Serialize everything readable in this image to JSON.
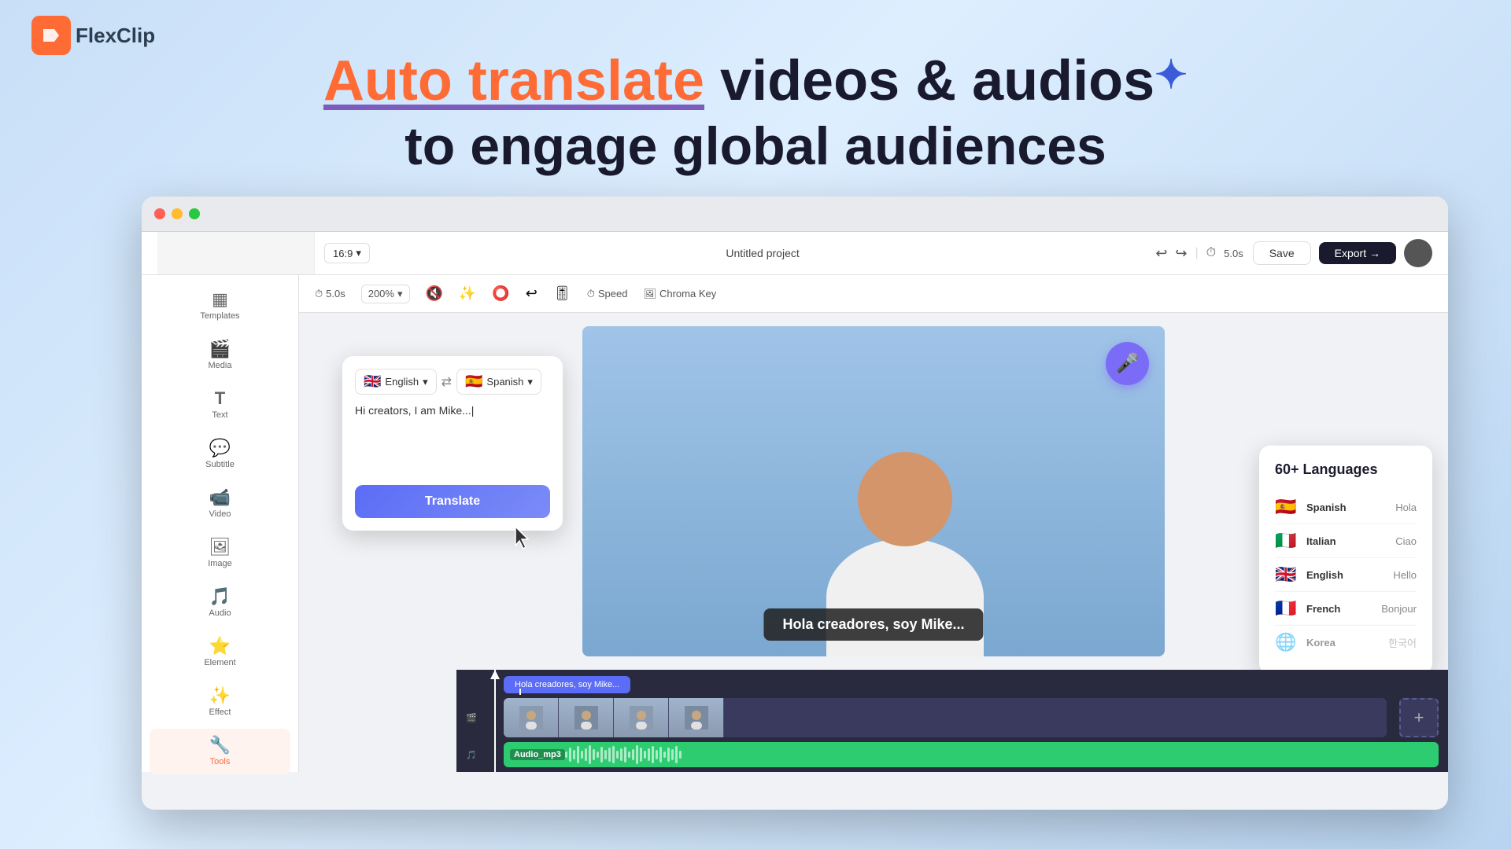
{
  "logo": {
    "icon": "F",
    "text": "FlexClip"
  },
  "hero": {
    "line1_highlight": "Auto translate",
    "line1_rest": " videos & audios",
    "line2": "to engage global audiences",
    "sparkle": "✦"
  },
  "window": {
    "titlebar": {
      "buttons": [
        "red",
        "yellow",
        "green"
      ]
    }
  },
  "toolbar": {
    "ratio": "16:9",
    "title": "Untitled project",
    "undo_label": "↩",
    "redo_label": "↪",
    "save_label": "Save",
    "export_label": "Export →",
    "time": "5.0s",
    "zoom": "200%"
  },
  "sub_toolbar": {
    "items": [
      "🔇",
      "✨",
      "⭕",
      "↩",
      "🎚",
      "⏱ Speed",
      "🖼 Chroma Key"
    ]
  },
  "sidebar": {
    "items": [
      {
        "id": "templates",
        "icon": "▦",
        "label": "Templates"
      },
      {
        "id": "media",
        "icon": "🎬",
        "label": "Media"
      },
      {
        "id": "text",
        "icon": "T",
        "label": "Text"
      },
      {
        "id": "subtitle",
        "icon": "💬",
        "label": "Subtitle"
      },
      {
        "id": "video",
        "icon": "📹",
        "label": "Video"
      },
      {
        "id": "image",
        "icon": "🖼",
        "label": "Image"
      },
      {
        "id": "audio",
        "icon": "🎵",
        "label": "Audio"
      },
      {
        "id": "element",
        "icon": "⭐",
        "label": "Element"
      },
      {
        "id": "effect",
        "icon": "✨",
        "label": "Effect"
      },
      {
        "id": "tools",
        "icon": "🔧",
        "label": "Tools",
        "active": true
      }
    ]
  },
  "translate_panel": {
    "source_lang": "English",
    "source_flag": "🇬🇧",
    "target_lang": "Spanish",
    "target_flag": "🇪🇸",
    "input_text": "Hi creators, I am Mike...",
    "btn_label": "Translate"
  },
  "video_preview": {
    "subtitle": "Hola creadores, soy Mike..."
  },
  "languages_panel": {
    "title": "60+ Languages",
    "items": [
      {
        "flag": "🇪🇸",
        "name": "Spanish",
        "word": "Hola"
      },
      {
        "flag": "🇮🇹",
        "name": "Italian",
        "word": "Ciao"
      },
      {
        "flag": "🇬🇧",
        "name": "English",
        "word": "Hello"
      },
      {
        "flag": "🇫🇷",
        "name": "French",
        "word": "Bonjour"
      },
      {
        "flag": "🌐",
        "name": "Korea",
        "word": "한국어"
      }
    ]
  },
  "timeline": {
    "clip_label": "Hola creadores, soy Mike...",
    "audio_label": "Audio_mp3",
    "add_btn": "+"
  }
}
